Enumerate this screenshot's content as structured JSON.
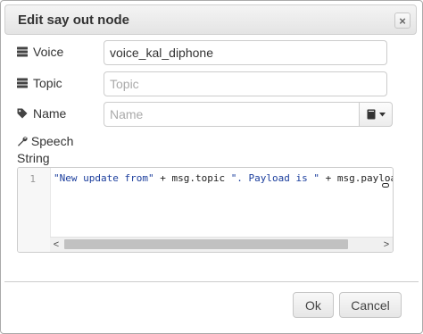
{
  "dialog": {
    "title": "Edit say out node",
    "close_label": "×"
  },
  "fields": {
    "voice": {
      "label": "Voice",
      "value": "voice_kal_diphone",
      "placeholder": "",
      "icon": "list-icon"
    },
    "topic": {
      "label": "Topic",
      "value": "",
      "placeholder": "Topic",
      "icon": "list-icon"
    },
    "name": {
      "label": "Name",
      "value": "",
      "placeholder": "Name",
      "icon": "tag-icon",
      "icon_button": "book-icon"
    },
    "speech": {
      "label_line1": "Speech",
      "label_line2": "String",
      "icon": "wrench-icon",
      "line_number": "1",
      "code_tokens": [
        {
          "kind": "str",
          "text": "\"New update from\""
        },
        {
          "kind": "plain",
          "text": " + msg.topic "
        },
        {
          "kind": "str",
          "text": "\". Payload is \""
        },
        {
          "kind": "plain",
          "text": " + msg.payload"
        }
      ]
    }
  },
  "buttons": {
    "ok": "Ok",
    "cancel": "Cancel"
  },
  "scrollbar": {
    "left_arrow": "<",
    "right_arrow": ">"
  }
}
